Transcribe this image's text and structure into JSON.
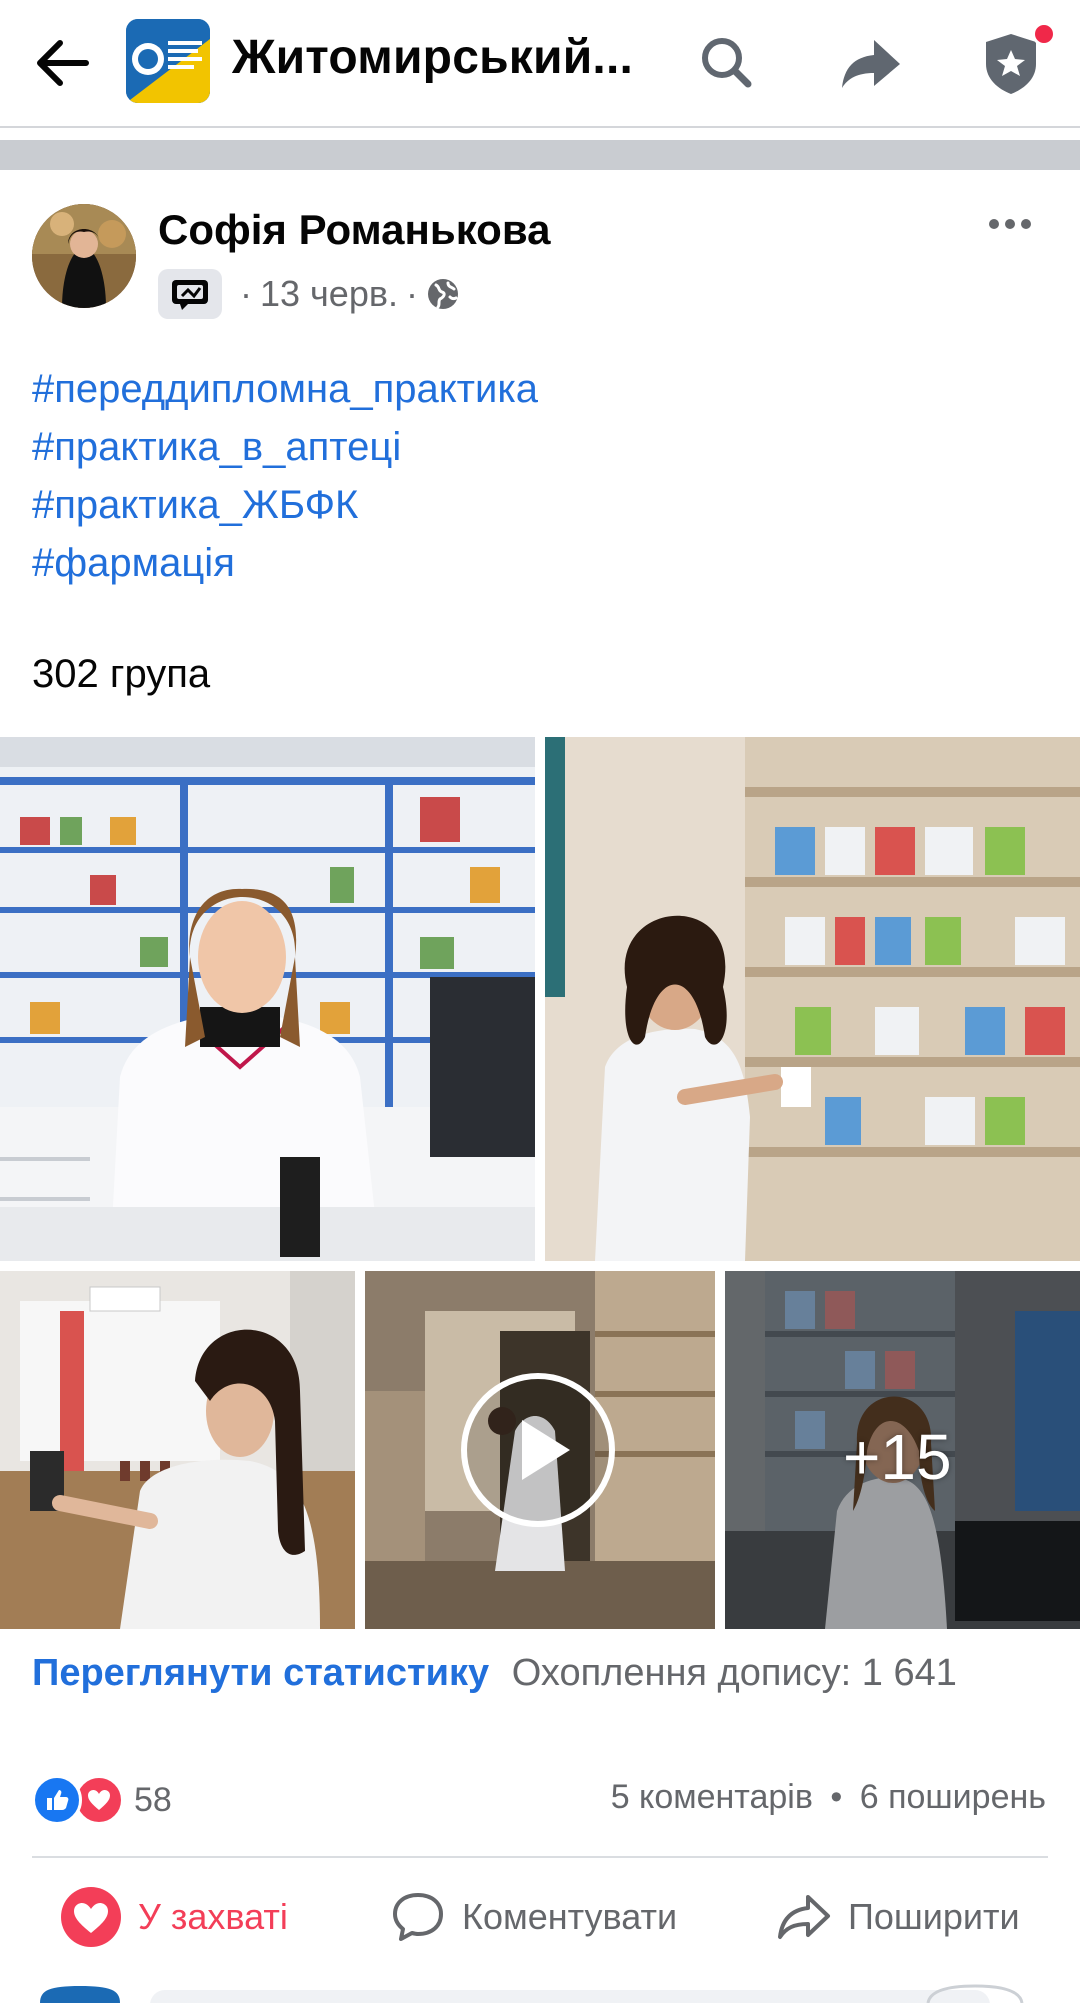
{
  "topbar": {
    "title": "Житомирський...",
    "icons": [
      "back-arrow-icon",
      "page-logo",
      "search-icon",
      "share-icon",
      "shield-star-icon"
    ],
    "notification_dot_color": "#f02849"
  },
  "post": {
    "author": "Софія Романькова",
    "date": "13 черв.",
    "separator": "·",
    "audience_icon": "globe-icon",
    "hashtags": [
      "#переддипломна_практика",
      "#практика_в_аптеці",
      "#практика_ЖБФК",
      "#фармація"
    ],
    "text": "302 група",
    "more_photos": "+15"
  },
  "insights": {
    "link": "Переглянути статистику",
    "reach": "Охоплення допису: 1 641"
  },
  "reactions": {
    "count": "58",
    "comments": "5 коментарів",
    "dot": "•",
    "shares": "6 поширень"
  },
  "actions": {
    "love": "У захваті",
    "comment": "Коментувати",
    "share": "Поширити"
  },
  "colors": {
    "link": "#216fdb",
    "love": "#f33e58",
    "like": "#1877f2",
    "secondary_text": "#65676b"
  }
}
